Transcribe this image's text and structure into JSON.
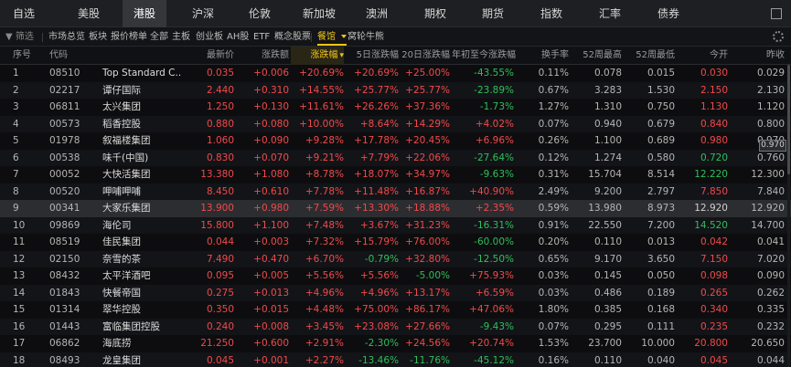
{
  "nav": {
    "tabs": [
      "自选",
      "美股",
      "港股",
      "沪深",
      "伦敦",
      "新加坡",
      "澳洲",
      "期权",
      "期货",
      "指数",
      "汇率",
      "债券"
    ],
    "active_tab": "港股"
  },
  "filter": {
    "filter_label": "筛选",
    "items": [
      "市场总览",
      "板块",
      "报价榜单",
      "全部",
      "主板",
      "创业板",
      "AH股",
      "ETF",
      "概念股票"
    ],
    "selected": "餐馆",
    "extra": "窝轮牛熊"
  },
  "table": {
    "headers": [
      "序号",
      "代码",
      "名称",
      "最新价",
      "涨跌额",
      "涨跌幅",
      "5日涨跌幅",
      "20日涨跌幅",
      "年初至今涨跌幅",
      "换手率",
      "52周最高",
      "52周最低",
      "今开",
      "昨收"
    ],
    "header_labels": [
      "序号",
      "代码",
      "",
      "最新价",
      "涨跌额",
      "涨跌幅",
      "5日涨跌幅",
      "20日涨跌幅",
      "年初至今涨跌幅",
      "换手率",
      "52周最高",
      "52周最低",
      "今开",
      "昨收"
    ],
    "sorted_column": "涨跌幅",
    "selected_row": 9,
    "tooltip": "0.970",
    "rows": [
      {
        "idx": "1",
        "code": "08510",
        "name": "Top Standard C...",
        "price": "0.035",
        "chg": "+0.006",
        "pct": "+20.69%",
        "d5": "+20.69%",
        "d20": "+25.00%",
        "ytd": "-43.55%",
        "turnover": "0.11%",
        "hi52": "0.078",
        "lo52": "0.015",
        "open": "0.030",
        "prev": "0.029",
        "price_c": "red",
        "chg_c": "red",
        "pct_c": "red",
        "d5_c": "red",
        "d20_c": "red",
        "ytd_c": "green",
        "open_c": "red"
      },
      {
        "idx": "2",
        "code": "02217",
        "name": "谭仔国际",
        "price": "2.440",
        "chg": "+0.310",
        "pct": "+14.55%",
        "d5": "+25.77%",
        "d20": "+25.77%",
        "ytd": "-23.89%",
        "turnover": "0.67%",
        "hi52": "3.283",
        "lo52": "1.530",
        "open": "2.150",
        "prev": "2.130",
        "price_c": "red",
        "chg_c": "red",
        "pct_c": "red",
        "d5_c": "red",
        "d20_c": "red",
        "ytd_c": "green",
        "open_c": "red"
      },
      {
        "idx": "3",
        "code": "06811",
        "name": "太兴集团",
        "price": "1.250",
        "chg": "+0.130",
        "pct": "+11.61%",
        "d5": "+26.26%",
        "d20": "+37.36%",
        "ytd": "-1.73%",
        "turnover": "1.27%",
        "hi52": "1.310",
        "lo52": "0.750",
        "open": "1.130",
        "prev": "1.120",
        "price_c": "red",
        "chg_c": "red",
        "pct_c": "red",
        "d5_c": "red",
        "d20_c": "red",
        "ytd_c": "green",
        "open_c": "red"
      },
      {
        "idx": "4",
        "code": "00573",
        "name": "稻香控股",
        "price": "0.880",
        "chg": "+0.080",
        "pct": "+10.00%",
        "d5": "+8.64%",
        "d20": "+14.29%",
        "ytd": "+4.02%",
        "turnover": "0.07%",
        "hi52": "0.940",
        "lo52": "0.679",
        "open": "0.840",
        "prev": "0.800",
        "price_c": "red",
        "chg_c": "red",
        "pct_c": "red",
        "d5_c": "red",
        "d20_c": "red",
        "ytd_c": "red",
        "open_c": "red"
      },
      {
        "idx": "5",
        "code": "01978",
        "name": "叙福楼集团",
        "price": "1.060",
        "chg": "+0.090",
        "pct": "+9.28%",
        "d5": "+17.78%",
        "d20": "+20.45%",
        "ytd": "+6.96%",
        "turnover": "0.26%",
        "hi52": "1.100",
        "lo52": "0.689",
        "open": "0.980",
        "prev": "0.970",
        "price_c": "red",
        "chg_c": "red",
        "pct_c": "red",
        "d5_c": "red",
        "d20_c": "red",
        "ytd_c": "red",
        "open_c": "red"
      },
      {
        "idx": "6",
        "code": "00538",
        "name": "味千(中国)",
        "price": "0.830",
        "chg": "+0.070",
        "pct": "+9.21%",
        "d5": "+7.79%",
        "d20": "+22.06%",
        "ytd": "-27.64%",
        "turnover": "0.12%",
        "hi52": "1.274",
        "lo52": "0.580",
        "open": "0.720",
        "prev": "0.760",
        "price_c": "red",
        "chg_c": "red",
        "pct_c": "red",
        "d5_c": "red",
        "d20_c": "red",
        "ytd_c": "green",
        "open_c": "green"
      },
      {
        "idx": "7",
        "code": "00052",
        "name": "大快活集团",
        "price": "13.380",
        "chg": "+1.080",
        "pct": "+8.78%",
        "d5": "+18.07%",
        "d20": "+34.97%",
        "ytd": "-9.63%",
        "turnover": "0.31%",
        "hi52": "15.704",
        "lo52": "8.514",
        "open": "12.220",
        "prev": "12.300",
        "price_c": "red",
        "chg_c": "red",
        "pct_c": "red",
        "d5_c": "red",
        "d20_c": "red",
        "ytd_c": "green",
        "open_c": "green"
      },
      {
        "idx": "8",
        "code": "00520",
        "name": "呷哺呷哺",
        "price": "8.450",
        "chg": "+0.610",
        "pct": "+7.78%",
        "d5": "+11.48%",
        "d20": "+16.87%",
        "ytd": "+40.90%",
        "turnover": "2.49%",
        "hi52": "9.200",
        "lo52": "2.797",
        "open": "7.850",
        "prev": "7.840",
        "price_c": "red",
        "chg_c": "red",
        "pct_c": "red",
        "d5_c": "red",
        "d20_c": "red",
        "ytd_c": "red",
        "open_c": "red"
      },
      {
        "idx": "9",
        "code": "00341",
        "name": "大家乐集团",
        "price": "13.900",
        "chg": "+0.980",
        "pct": "+7.59%",
        "d5": "+13.30%",
        "d20": "+18.88%",
        "ytd": "+2.35%",
        "turnover": "0.59%",
        "hi52": "13.980",
        "lo52": "8.973",
        "open": "12.920",
        "prev": "12.920",
        "price_c": "red",
        "chg_c": "red",
        "pct_c": "red",
        "d5_c": "red",
        "d20_c": "red",
        "ytd_c": "red",
        "open_c": "neu"
      },
      {
        "idx": "10",
        "code": "09869",
        "name": "海伦司",
        "price": "15.800",
        "chg": "+1.100",
        "pct": "+7.48%",
        "d5": "+3.67%",
        "d20": "+31.23%",
        "ytd": "-16.31%",
        "turnover": "0.91%",
        "hi52": "22.550",
        "lo52": "7.200",
        "open": "14.520",
        "prev": "14.700",
        "price_c": "red",
        "chg_c": "red",
        "pct_c": "red",
        "d5_c": "red",
        "d20_c": "red",
        "ytd_c": "green",
        "open_c": "green"
      },
      {
        "idx": "11",
        "code": "08519",
        "name": "佳民集团",
        "price": "0.044",
        "chg": "+0.003",
        "pct": "+7.32%",
        "d5": "+15.79%",
        "d20": "+76.00%",
        "ytd": "-60.00%",
        "turnover": "0.20%",
        "hi52": "0.110",
        "lo52": "0.013",
        "open": "0.042",
        "prev": "0.041",
        "price_c": "red",
        "chg_c": "red",
        "pct_c": "red",
        "d5_c": "red",
        "d20_c": "red",
        "ytd_c": "green",
        "open_c": "red"
      },
      {
        "idx": "12",
        "code": "02150",
        "name": "奈雪的茶",
        "price": "7.490",
        "chg": "+0.470",
        "pct": "+6.70%",
        "d5": "-0.79%",
        "d20": "+32.80%",
        "ytd": "-12.50%",
        "turnover": "0.65%",
        "hi52": "9.170",
        "lo52": "3.650",
        "open": "7.150",
        "prev": "7.020",
        "price_c": "red",
        "chg_c": "red",
        "pct_c": "red",
        "d5_c": "green",
        "d20_c": "red",
        "ytd_c": "green",
        "open_c": "red"
      },
      {
        "idx": "13",
        "code": "08432",
        "name": "太平洋酒吧",
        "price": "0.095",
        "chg": "+0.005",
        "pct": "+5.56%",
        "d5": "+5.56%",
        "d20": "-5.00%",
        "ytd": "+75.93%",
        "turnover": "0.03%",
        "hi52": "0.145",
        "lo52": "0.050",
        "open": "0.098",
        "prev": "0.090",
        "price_c": "red",
        "chg_c": "red",
        "pct_c": "red",
        "d5_c": "red",
        "d20_c": "green",
        "ytd_c": "red",
        "open_c": "red"
      },
      {
        "idx": "14",
        "code": "01843",
        "name": "快餐帝国",
        "price": "0.275",
        "chg": "+0.013",
        "pct": "+4.96%",
        "d5": "+4.96%",
        "d20": "+13.17%",
        "ytd": "+6.59%",
        "turnover": "0.03%",
        "hi52": "0.486",
        "lo52": "0.189",
        "open": "0.265",
        "prev": "0.262",
        "price_c": "red",
        "chg_c": "red",
        "pct_c": "red",
        "d5_c": "red",
        "d20_c": "red",
        "ytd_c": "red",
        "open_c": "red"
      },
      {
        "idx": "15",
        "code": "01314",
        "name": "翠华控股",
        "price": "0.350",
        "chg": "+0.015",
        "pct": "+4.48%",
        "d5": "+75.00%",
        "d20": "+86.17%",
        "ytd": "+47.06%",
        "turnover": "1.80%",
        "hi52": "0.385",
        "lo52": "0.168",
        "open": "0.340",
        "prev": "0.335",
        "price_c": "red",
        "chg_c": "red",
        "pct_c": "red",
        "d5_c": "red",
        "d20_c": "red",
        "ytd_c": "red",
        "open_c": "red"
      },
      {
        "idx": "16",
        "code": "01443",
        "name": "富临集团控股",
        "price": "0.240",
        "chg": "+0.008",
        "pct": "+3.45%",
        "d5": "+23.08%",
        "d20": "+27.66%",
        "ytd": "-9.43%",
        "turnover": "0.07%",
        "hi52": "0.295",
        "lo52": "0.111",
        "open": "0.235",
        "prev": "0.232",
        "price_c": "red",
        "chg_c": "red",
        "pct_c": "red",
        "d5_c": "red",
        "d20_c": "red",
        "ytd_c": "green",
        "open_c": "red"
      },
      {
        "idx": "17",
        "code": "06862",
        "name": "海底捞",
        "price": "21.250",
        "chg": "+0.600",
        "pct": "+2.91%",
        "d5": "-2.30%",
        "d20": "+24.56%",
        "ytd": "+20.74%",
        "turnover": "1.53%",
        "hi52": "23.700",
        "lo52": "10.000",
        "open": "20.800",
        "prev": "20.650",
        "price_c": "red",
        "chg_c": "red",
        "pct_c": "red",
        "d5_c": "green",
        "d20_c": "red",
        "ytd_c": "red",
        "open_c": "red"
      },
      {
        "idx": "18",
        "code": "08493",
        "name": "龙皇集团",
        "price": "0.045",
        "chg": "+0.001",
        "pct": "+2.27%",
        "d5": "-13.46%",
        "d20": "-11.76%",
        "ytd": "-45.12%",
        "turnover": "0.16%",
        "hi52": "0.110",
        "lo52": "0.040",
        "open": "0.045",
        "prev": "0.044",
        "price_c": "red",
        "chg_c": "red",
        "pct_c": "red",
        "d5_c": "green",
        "d20_c": "green",
        "ytd_c": "green",
        "open_c": "red"
      }
    ]
  },
  "colors": {
    "up": "#f14a4a",
    "down": "#2fbf5a",
    "accent": "#f0c419",
    "background": "#0d0d0f"
  }
}
